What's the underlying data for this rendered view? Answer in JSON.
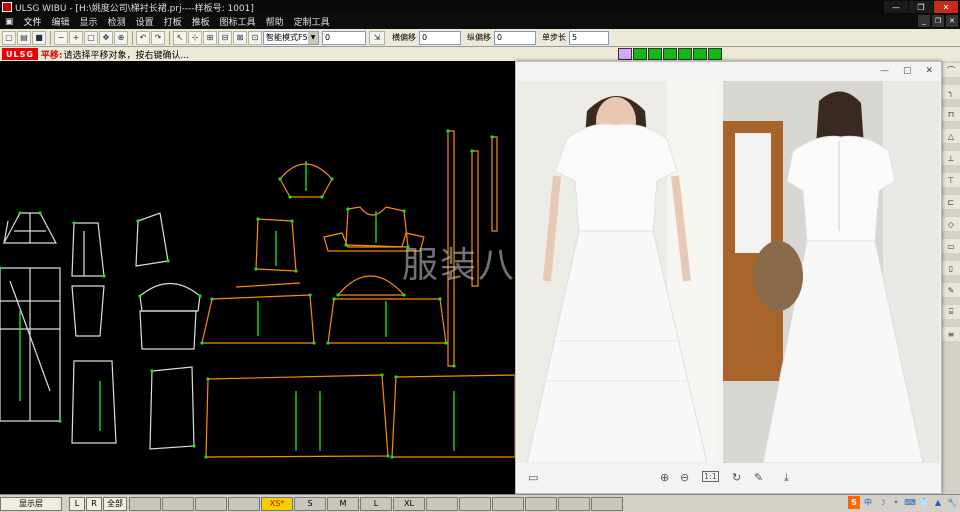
{
  "titlebar": {
    "title": "ULSG WIBU - [H:\\姚度公司\\梯衬长裙.prj----样板号: 1001]",
    "min": "—",
    "restore": "❐",
    "close": "✕"
  },
  "menu": [
    "文件",
    "编辑",
    "显示",
    "检测",
    "设置",
    "打板",
    "推板",
    "图标工具",
    "帮助",
    "定制工具"
  ],
  "toolbar": {
    "mode_select": "智能模式F5",
    "field1": "0",
    "offset_h_label": "横偏移",
    "offset_h": "0",
    "offset_v_label": "纵偏移",
    "offset_v": "0",
    "step_label": "单步长",
    "step": "5"
  },
  "prompt": {
    "logo": "ULSG",
    "mode": "平移:",
    "message": "请选择平移对象，按右键确认..."
  },
  "colors": {
    "pattern_line": "#ff8c00",
    "inner_line": "#ffffff",
    "point": "#22dd22",
    "center_line": "#22ff22",
    "active_size": "#f5d000"
  },
  "viewer": {
    "window_controls": [
      "—",
      "▢",
      "✕"
    ],
    "tools": [
      "save-icon",
      "zoom-in-icon",
      "zoom-out-icon",
      "fit-icon",
      "rotate-icon",
      "edit-icon",
      "download-icon"
    ],
    "fit_label": "1:1"
  },
  "watermark": "服装八场",
  "bottombar": {
    "layer_label": "显示层",
    "l": "L",
    "r": "R",
    "all": "全部",
    "sizes": [
      "XS*",
      "S",
      "M",
      "L",
      "XL"
    ],
    "active_size_index": 0
  },
  "tray": [
    "S",
    "中",
    "☽",
    "•",
    "⌨",
    "👕",
    "▲",
    "🔧"
  ]
}
